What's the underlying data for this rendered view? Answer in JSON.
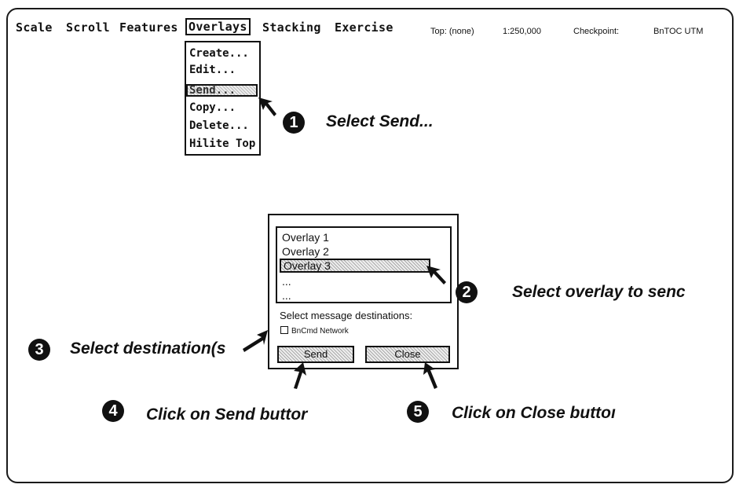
{
  "menubar": {
    "items": [
      "Scale",
      "Scroll",
      "Features",
      "Overlays",
      "Stacking",
      "Exercise"
    ],
    "status": {
      "top": "Top: (none)",
      "scale": "1:250,000",
      "checkpoint": "Checkpoint:",
      "system": "BnTOC UTM"
    }
  },
  "overlays_menu": {
    "items": [
      "Create...",
      "Edit...",
      "Send...",
      "Copy...",
      "Delete...",
      "Hilite Top"
    ],
    "highlighted": "Send..."
  },
  "dialog": {
    "overlays": [
      "Overlay 1",
      "Overlay 2",
      "Overlay 3",
      "...",
      "..."
    ],
    "selected": "Overlay 3",
    "dest_label": "Select message destinations:",
    "dest_option": "BnCmd Network",
    "send_button": "Send",
    "close_button": "Close"
  },
  "instructions": [
    {
      "num": "1",
      "text": "Select Send..."
    },
    {
      "num": "2",
      "text": "Select overlay to senc"
    },
    {
      "num": "3",
      "text": "Select destination(s"
    },
    {
      "num": "4",
      "text": "Click on Send buttor"
    },
    {
      "num": "5",
      "text": "Click on Close buttoı"
    }
  ]
}
